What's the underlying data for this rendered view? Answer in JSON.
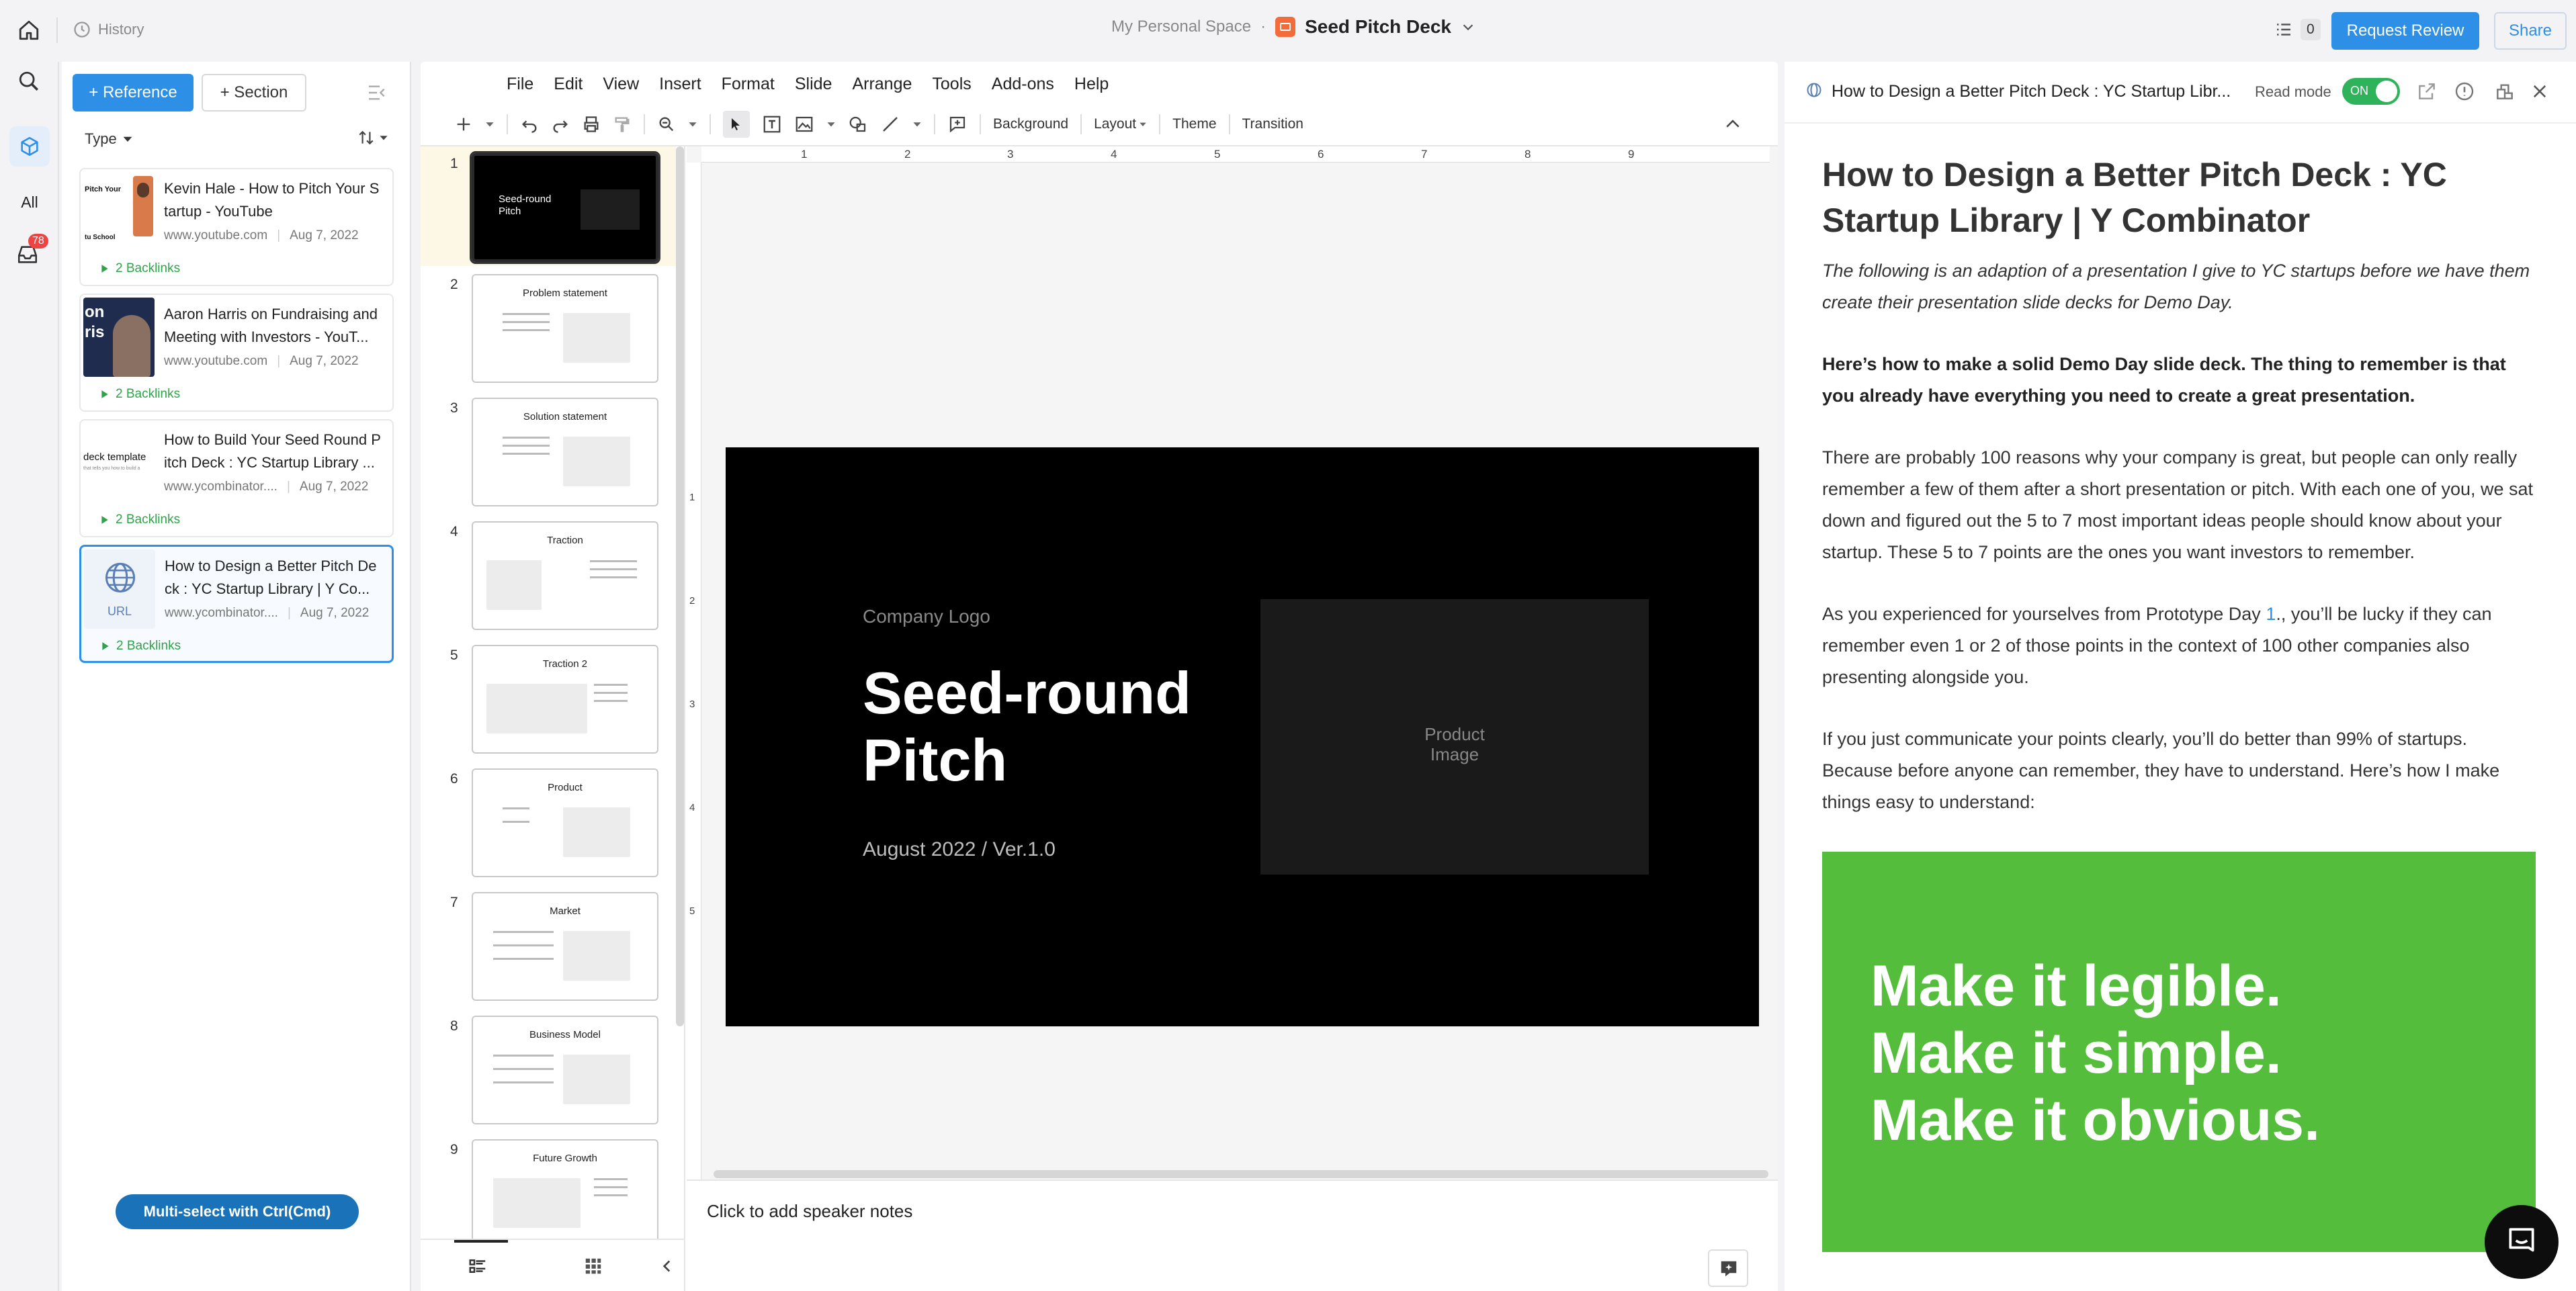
{
  "topbar": {
    "history": "History",
    "space": "My Personal Space",
    "sep": "·",
    "doc_title": "Seed Pitch Deck",
    "task_count": "0",
    "request_review": "Request Review",
    "share": "Share"
  },
  "rail": {
    "all_label": "All",
    "inbox_badge": "78"
  },
  "refs": {
    "add_reference": "+ Reference",
    "add_section": "+ Section",
    "type_filter": "Type",
    "multi_select": "Multi-select with Ctrl(Cmd)",
    "items": [
      {
        "title": "Kevin Hale - How to Pitch Your Startup - YouTube",
        "title_l1": "Kevin Hale - How to Pitch Your S",
        "title_l2": "tartup - YouTube",
        "domain": "www.youtube.com",
        "date": "Aug 7, 2022",
        "backlinks": "2 Backlinks",
        "thumb_text_1": "Pitch Your",
        "thumb_text_2": "tu School"
      },
      {
        "title": "Aaron Harris on Fundraising and Meeting with Investors - YouT...",
        "title_l1": "Aaron Harris on Fundraising and",
        "title_l2": "Meeting with Investors - YouT...",
        "domain": "www.youtube.com",
        "date": "Aug 7, 2022",
        "backlinks": "2 Backlinks",
        "thumb_text_1": "on",
        "thumb_text_2": "ris"
      },
      {
        "title": "How to Build Your Seed Round Pitch Deck : YC Startup Library ...",
        "title_l1": "How to Build Your Seed Round P",
        "title_l2": "itch Deck : YC Startup Library ...",
        "domain": "www.ycombinator....",
        "date": "Aug 7, 2022",
        "backlinks": "2 Backlinks",
        "thumb_text_1": "deck template",
        "thumb_text_2": "that tells you how to build a"
      },
      {
        "title": "How to Design a Better Pitch Deck : YC Startup Library | Y Co...",
        "title_l1": "How to Design a Better Pitch De",
        "title_l2": "ck : YC Startup Library | Y Co...",
        "domain": "www.ycombinator....",
        "date": "Aug 7, 2022",
        "backlinks": "2 Backlinks",
        "thumb_text_1": "URL",
        "thumb_text_2": ""
      }
    ]
  },
  "editor": {
    "menu": [
      "File",
      "Edit",
      "View",
      "Insert",
      "Format",
      "Slide",
      "Arrange",
      "Tools",
      "Add-ons",
      "Help"
    ],
    "toolbar": {
      "background": "Background",
      "layout": "Layout",
      "theme": "Theme",
      "transition": "Transition"
    },
    "ruler_h": [
      "1",
      "2",
      "3",
      "4",
      "5",
      "6",
      "7",
      "8",
      "9"
    ],
    "ruler_v": [
      "1",
      "2",
      "3",
      "4",
      "5"
    ],
    "slides": [
      {
        "num": "1",
        "title": "Seed-round Pitch"
      },
      {
        "num": "2",
        "title": "Problem statement"
      },
      {
        "num": "3",
        "title": "Solution statement"
      },
      {
        "num": "4",
        "title": "Traction"
      },
      {
        "num": "5",
        "title": "Traction 2"
      },
      {
        "num": "6",
        "title": "Product"
      },
      {
        "num": "7",
        "title": "Market"
      },
      {
        "num": "8",
        "title": "Business Model"
      },
      {
        "num": "9",
        "title": "Future Growth"
      }
    ],
    "canvas": {
      "company_logo": "Company Logo",
      "title_l1": "Seed-round",
      "title_l2": "Pitch",
      "subtitle": "August 2022 / Ver.1.0",
      "product_image_l1": "Product",
      "product_image_l2": "Image"
    },
    "speaker_notes": "Click to add speaker notes"
  },
  "reader": {
    "header_title": "How to Design a Better Pitch Deck : YC Startup Libr...",
    "read_mode": "Read mode",
    "toggle": "ON",
    "h1": "How to Design a Better Pitch Deck : YC Startup Library | Y Combinator",
    "intro": "The following is an adaption of a presentation I give to YC startups before we have them create their presentation slide decks for Demo Day.",
    "bold_para": "Here’s how to make a solid Demo Day slide deck. The thing to remember is that you already have everything you need to create a great presentation.",
    "para1": "There are probably 100 reasons why your company is great, but people can only really remember a few of them after a short presentation or pitch. With each one of you, we sat down and figured out the 5 to 7 most important ideas people should know about your startup. These 5 to 7 points are the ones you want investors to remember.",
    "para2_a": "As you experienced for yourselves from Prototype Day ",
    "para2_link": "1",
    "para2_b": "., you’ll be lucky if they can remember even 1 or 2 of those points in the context of 100 other companies also presenting alongside you.",
    "para3": "If you just communicate your points clearly, you’ll do better than 99% of startups. Because before anyone can remember, they have to understand. Here’s how I make things easy to understand:",
    "image_lines": [
      "Make it legible.",
      "Make it simple.",
      "Make it obvious."
    ]
  },
  "colors": {
    "accent": "#2d8fe6",
    "green": "#54be3c",
    "badge": "#ef4444",
    "toggle": "#2fb35a"
  }
}
